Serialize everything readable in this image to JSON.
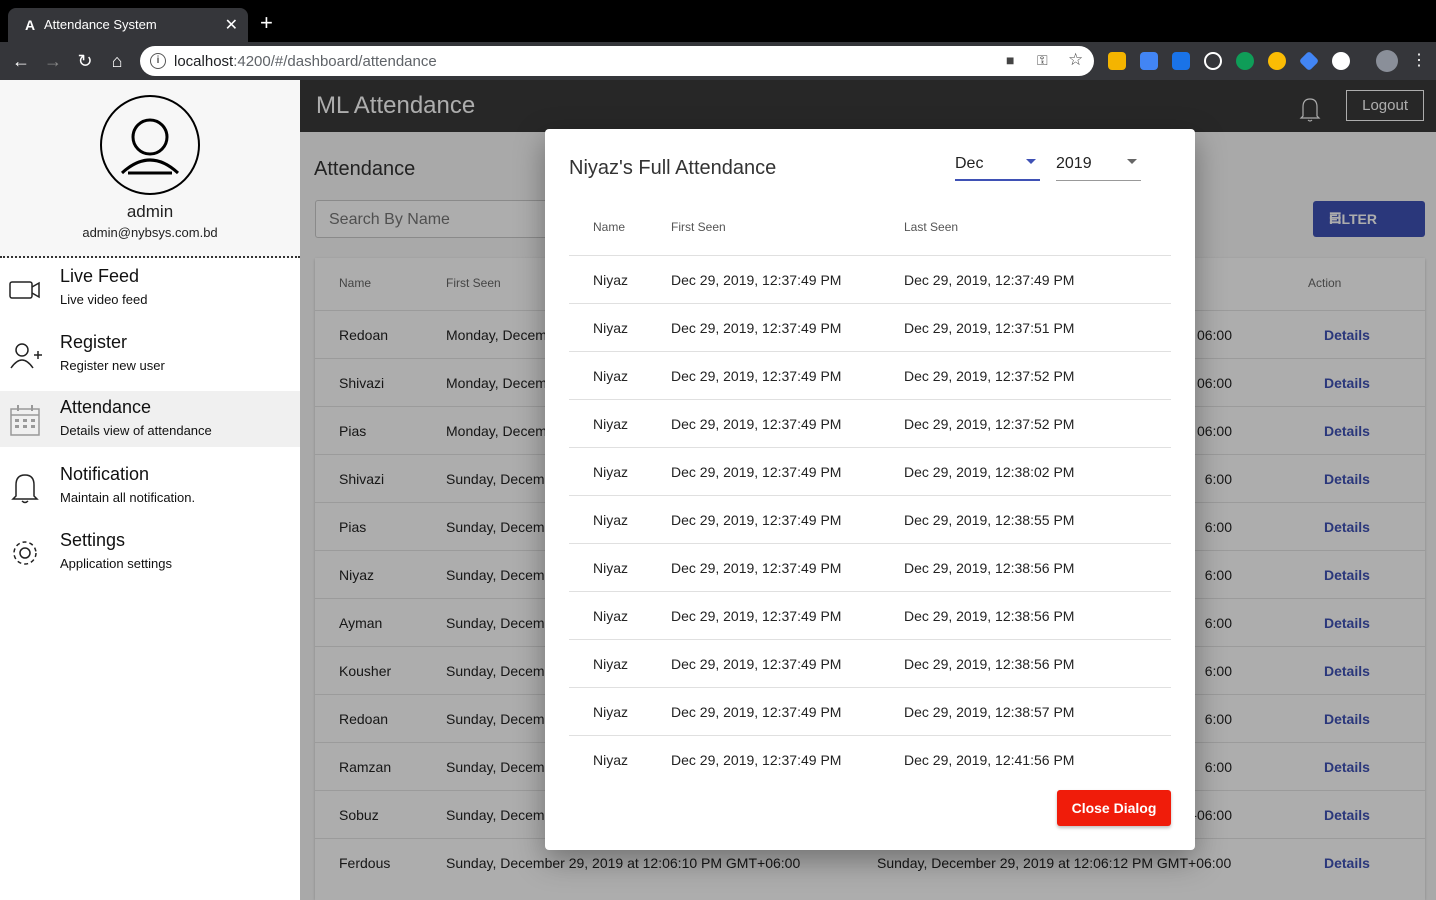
{
  "browser": {
    "tab_title": "Attendance System",
    "new_tab": "+",
    "url_host": "localhost",
    "url_rest": ":4200/#/dashboard/attendance"
  },
  "sidebar": {
    "name": "admin",
    "email": "admin@nybsys.com.bd",
    "items": [
      {
        "title": "Live Feed",
        "subtitle": "Live video feed",
        "icon": "video-camera-icon"
      },
      {
        "title": "Register",
        "subtitle": "Register new user",
        "icon": "add-user-icon"
      },
      {
        "title": "Attendance",
        "subtitle": "Details view of attendance",
        "icon": "calendar-icon"
      },
      {
        "title": "Notification",
        "subtitle": "Maintain all notification.",
        "icon": "bell-icon"
      },
      {
        "title": "Settings",
        "subtitle": "Application settings",
        "icon": "gear-icon"
      }
    ]
  },
  "header": {
    "title": "ML Attendance",
    "logout": "Logout"
  },
  "page": {
    "title": "Attendance",
    "search_placeholder": "Search By Name",
    "filter": "FILTER"
  },
  "table": {
    "headers": {
      "name": "Name",
      "first_seen": "First Seen",
      "action": "Action"
    },
    "rows": [
      {
        "name": "Redoan",
        "first": "Monday, Decem",
        "last": "06:00",
        "action": "Details"
      },
      {
        "name": "Shivazi",
        "first": "Monday, Decem",
        "last": "06:00",
        "action": "Details"
      },
      {
        "name": "Pias",
        "first": "Monday, Decem",
        "last": "06:00",
        "action": "Details"
      },
      {
        "name": "Shivazi",
        "first": "Sunday, Decem",
        "last": "6:00",
        "action": "Details"
      },
      {
        "name": "Pias",
        "first": "Sunday, Decem",
        "last": "6:00",
        "action": "Details"
      },
      {
        "name": "Niyaz",
        "first": "Sunday, Decem",
        "last": "6:00",
        "action": "Details"
      },
      {
        "name": "Ayman",
        "first": "Sunday, Decem",
        "last": "6:00",
        "action": "Details"
      },
      {
        "name": "Kousher",
        "first": "Sunday, Decem",
        "last": "6:00",
        "action": "Details"
      },
      {
        "name": "Redoan",
        "first": "Sunday, Decem",
        "last": "6:00",
        "action": "Details"
      },
      {
        "name": "Ramzan",
        "first": "Sunday, Decem",
        "last": "6:00",
        "action": "Details"
      },
      {
        "name": "Sobuz",
        "first": "Sunday, Decem",
        "last": "-06:00",
        "action": "Details"
      },
      {
        "name": "Ferdous",
        "first": "Sunday, December 29, 2019 at 12:06:10 PM GMT+06:00",
        "last": "Sunday, December 29, 2019 at 12:06:12 PM GMT+06:00",
        "action": "Details"
      }
    ]
  },
  "dialog": {
    "title": "Niyaz's Full Attendance",
    "month": "Dec",
    "year": "2019",
    "headers": {
      "name": "Name",
      "first_seen": "First Seen",
      "last_seen": "Last Seen"
    },
    "rows": [
      {
        "name": "Niyaz",
        "first": "Dec 29, 2019, 12:37:49 PM",
        "last": "Dec 29, 2019, 12:37:49 PM"
      },
      {
        "name": "Niyaz",
        "first": "Dec 29, 2019, 12:37:49 PM",
        "last": "Dec 29, 2019, 12:37:51 PM"
      },
      {
        "name": "Niyaz",
        "first": "Dec 29, 2019, 12:37:49 PM",
        "last": "Dec 29, 2019, 12:37:52 PM"
      },
      {
        "name": "Niyaz",
        "first": "Dec 29, 2019, 12:37:49 PM",
        "last": "Dec 29, 2019, 12:37:52 PM"
      },
      {
        "name": "Niyaz",
        "first": "Dec 29, 2019, 12:37:49 PM",
        "last": "Dec 29, 2019, 12:38:02 PM"
      },
      {
        "name": "Niyaz",
        "first": "Dec 29, 2019, 12:37:49 PM",
        "last": "Dec 29, 2019, 12:38:55 PM"
      },
      {
        "name": "Niyaz",
        "first": "Dec 29, 2019, 12:37:49 PM",
        "last": "Dec 29, 2019, 12:38:56 PM"
      },
      {
        "name": "Niyaz",
        "first": "Dec 29, 2019, 12:37:49 PM",
        "last": "Dec 29, 2019, 12:38:56 PM"
      },
      {
        "name": "Niyaz",
        "first": "Dec 29, 2019, 12:37:49 PM",
        "last": "Dec 29, 2019, 12:38:56 PM"
      },
      {
        "name": "Niyaz",
        "first": "Dec 29, 2019, 12:37:49 PM",
        "last": "Dec 29, 2019, 12:38:57 PM"
      },
      {
        "name": "Niyaz",
        "first": "Dec 29, 2019, 12:37:49 PM",
        "last": "Dec 29, 2019, 12:41:56 PM"
      }
    ],
    "close": "Close Dialog"
  },
  "colors": {
    "primary": "#3f51b5",
    "danger": "#f01c0a",
    "appbar": "#3a3a3a"
  }
}
